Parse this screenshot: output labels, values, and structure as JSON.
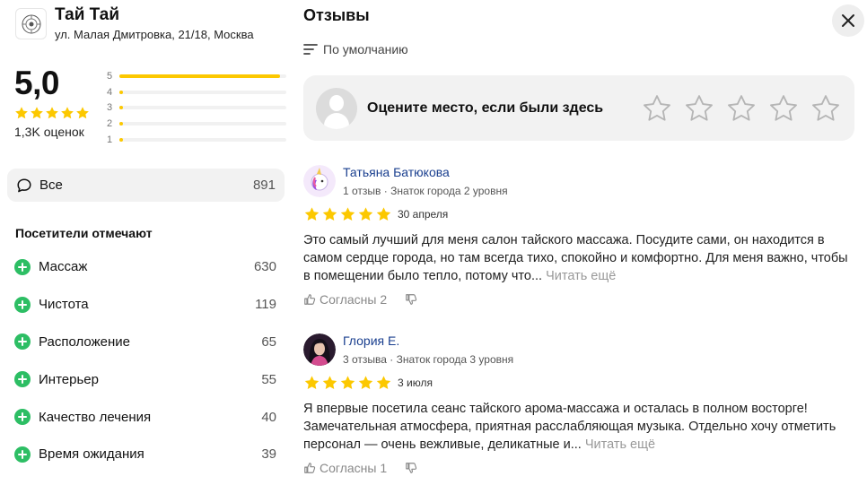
{
  "business": {
    "name": "Тай Тай",
    "address": "ул. Малая Дмитровка, 21/18, Москва",
    "rating": "5,0",
    "reviews_count_label": "1,3K оценок"
  },
  "distribution": [
    {
      "stars": "5",
      "fraction": 0.96
    },
    {
      "stars": "4",
      "fraction": 0.02
    },
    {
      "stars": "3",
      "fraction": 0.02
    },
    {
      "stars": "2",
      "fraction": 0.02
    },
    {
      "stars": "1",
      "fraction": 0.02
    }
  ],
  "filter_all": {
    "label": "Все",
    "count": "891"
  },
  "visitors": {
    "title": "Посетители отмечают",
    "aspects": [
      {
        "name": "Массаж",
        "count": "630"
      },
      {
        "name": "Чистота",
        "count": "119"
      },
      {
        "name": "Расположение",
        "count": "65"
      },
      {
        "name": "Интерьер",
        "count": "55"
      },
      {
        "name": "Качество лечения",
        "count": "40"
      },
      {
        "name": "Время ожидания",
        "count": "39"
      }
    ]
  },
  "reviews_panel": {
    "title": "Отзывы",
    "sort_label": "По умолчанию",
    "rate_prompt": "Оцените место, если были здесь"
  },
  "reviews": [
    {
      "author": "Татьяна Батюкова",
      "meta": "1 отзыв · Знаток города 2 уровня",
      "stars": 5,
      "date": "30 апреля",
      "text": "Это самый лучший для меня салон тайского массажа. Посудите сами, он находится в самом сердце города, но там всегда тихо, спокойно и комфортно. Для меня важно, чтобы в помещении было тепло, потому что...",
      "read_more": "Читать ещё",
      "likes": "Согласны 2"
    },
    {
      "author": "Глория Е.",
      "meta": "3 отзыва · Знаток города 3 уровня",
      "stars": 5,
      "date": "3 июля",
      "text": "Я впервые посетила сеанс тайского арома-массажа и осталась в полном восторге! Замечательная атмосфера, приятная расслабляющая музыка. Отдельно хочу отметить персонал — очень вежливые, деликатные и...",
      "read_more": "Читать ещё",
      "likes": "Согласны 1"
    }
  ],
  "colors": {
    "star": "#fcc800",
    "plus": "#2dbe64",
    "link": "#1a3f8f",
    "pill_bg": "#f2f2f2"
  }
}
